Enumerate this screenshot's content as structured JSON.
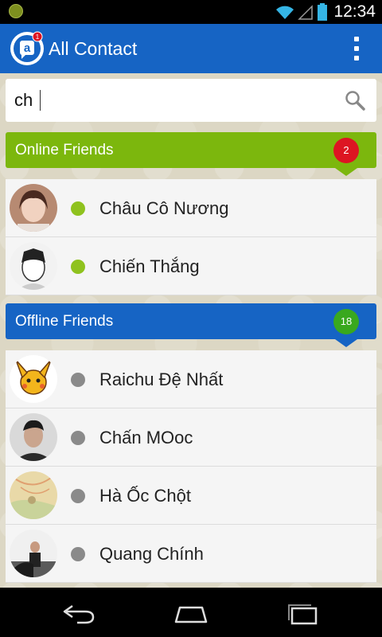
{
  "status_bar": {
    "time": "12:34",
    "icons": [
      "wifi-icon",
      "signal-icon",
      "battery-icon"
    ]
  },
  "app_bar": {
    "title": "All Contact",
    "logo_badge": "1",
    "logo_letter": "a",
    "menu_icon": "overflow-menu-icon"
  },
  "search": {
    "value": "ch",
    "icon": "search-icon"
  },
  "online_section": {
    "label": "Online Friends",
    "count": "2",
    "friends": [
      {
        "name": "Châu Cô Nương",
        "status": "online"
      },
      {
        "name": "Chiến Thắng",
        "status": "online"
      }
    ]
  },
  "offline_section": {
    "label": "Offline Friends",
    "count": "18",
    "friends": [
      {
        "name": "Raichu Đệ Nhất",
        "status": "offline"
      },
      {
        "name": "Chấn MOoc",
        "status": "offline"
      },
      {
        "name": "Hà Ốc Chột",
        "status": "offline"
      },
      {
        "name": "Quang Chính",
        "status": "offline"
      }
    ]
  },
  "nav_bar": {
    "buttons": [
      "back-icon",
      "home-icon",
      "recent-apps-icon"
    ]
  },
  "colors": {
    "app_bar": "#1664c4",
    "online_header": "#7cb70d",
    "offline_header": "#1664c4",
    "online_badge": "#dd1522",
    "offline_badge": "#39a81e",
    "online_dot": "#8fc21e",
    "offline_dot": "#8a8a8a"
  }
}
